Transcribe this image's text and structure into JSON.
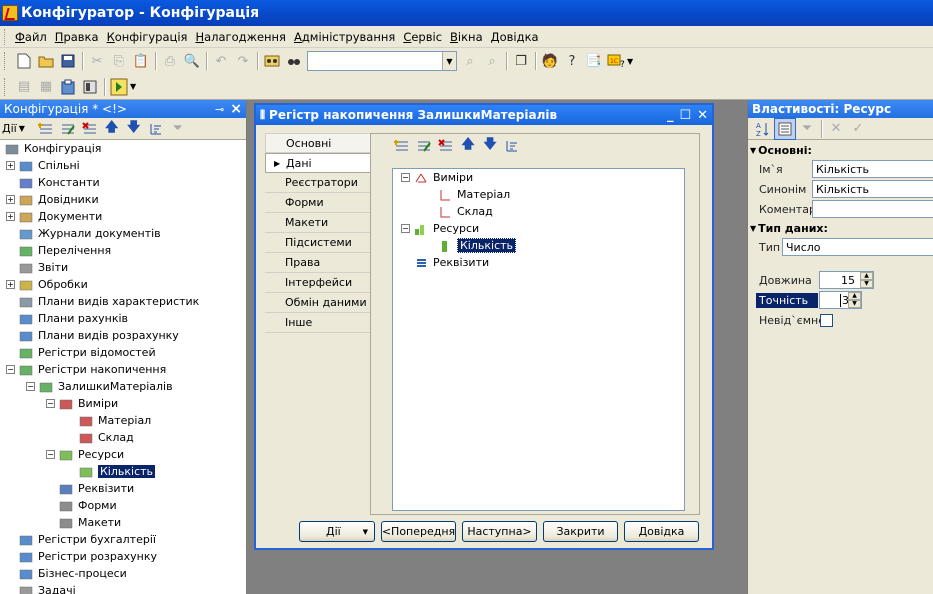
{
  "window": {
    "title": "Конфігуратор - Конфігурація"
  },
  "menu": [
    "Файл",
    "Правка",
    "Конфігурація",
    "Налагодження",
    "Адміністрування",
    "Сервіс",
    "Вікна",
    "Довідка"
  ],
  "left_panel": {
    "title": "Конфігурація * <!>",
    "actions_label": "Дії",
    "tree": [
      {
        "label": "Конфігурація",
        "icon": "config-icon"
      },
      {
        "label": "Спільні",
        "icon": "common-icon"
      },
      {
        "label": "Константи",
        "icon": "constants-icon"
      },
      {
        "label": "Довідники",
        "icon": "catalogs-icon"
      },
      {
        "label": "Документи",
        "icon": "documents-icon"
      },
      {
        "label": "Журнали документів",
        "icon": "journals-icon"
      },
      {
        "label": "Перелічення",
        "icon": "enums-icon"
      },
      {
        "label": "Звіти",
        "icon": "reports-icon"
      },
      {
        "label": "Обробки",
        "icon": "processing-icon"
      },
      {
        "label": "Плани видів характеристик",
        "icon": "char-plans-icon"
      },
      {
        "label": "Плани рахунків",
        "icon": "accounts-icon"
      },
      {
        "label": "Плани видів розрахунку",
        "icon": "calc-plans-icon"
      },
      {
        "label": "Регістри відомостей",
        "icon": "info-registers-icon"
      },
      {
        "label": "Регістри накопичення",
        "icon": "accum-registers-icon"
      },
      {
        "label": "ЗалишкиМатеріалів",
        "icon": "register-icon"
      },
      {
        "label": "Виміри",
        "icon": "dimensions-icon"
      },
      {
        "label": "Матеріал",
        "icon": "dimension-icon"
      },
      {
        "label": "Склад",
        "icon": "dimension-icon"
      },
      {
        "label": "Ресурси",
        "icon": "resources-icon"
      },
      {
        "label": "Кількість",
        "icon": "resource-icon"
      },
      {
        "label": "Реквізити",
        "icon": "attributes-icon"
      },
      {
        "label": "Форми",
        "icon": "forms-icon"
      },
      {
        "label": "Макети",
        "icon": "templates-icon"
      },
      {
        "label": "Регістри бухгалтерії",
        "icon": "acc-registers-icon"
      },
      {
        "label": "Регістри розрахунку",
        "icon": "calc-registers-icon"
      },
      {
        "label": "Бізнес-процеси",
        "icon": "bp-icon"
      },
      {
        "label": "Задачі",
        "icon": "tasks-icon"
      }
    ]
  },
  "dialog": {
    "title": "Регістр накопичення ЗалишкиМатеріалів",
    "tabs": [
      "Основні",
      "Дані",
      "Реєстратори",
      "Форми",
      "Макети",
      "Підсистеми",
      "Права",
      "Інтерфейси",
      "Обмін даними",
      "Інше"
    ],
    "tree": [
      {
        "label": "Виміри"
      },
      {
        "label": "Матеріал"
      },
      {
        "label": "Склад"
      },
      {
        "label": "Ресурси"
      },
      {
        "label": "Кількість"
      },
      {
        "label": "Реквізити"
      }
    ],
    "buttons": {
      "actions": "Дії",
      "prev": "<Попередня",
      "next": "Наступна>",
      "close": "Закрити",
      "help": "Довідка"
    }
  },
  "properties": {
    "title": "Властивості: Ресурс",
    "group_main": "Основні:",
    "name_label": "Ім`я",
    "name_value": "Кількість",
    "synonym_label": "Синонім",
    "synonym_value": "Кількість",
    "comment_label": "Коментар",
    "comment_value": "",
    "group_type": "Тип даних:",
    "type_label": "Тип",
    "type_value": "Число",
    "length_label": "Довжина",
    "length_value": "15",
    "precision_label": "Точність",
    "precision_value": "3",
    "nonneg_label": "Невід`ємне"
  }
}
